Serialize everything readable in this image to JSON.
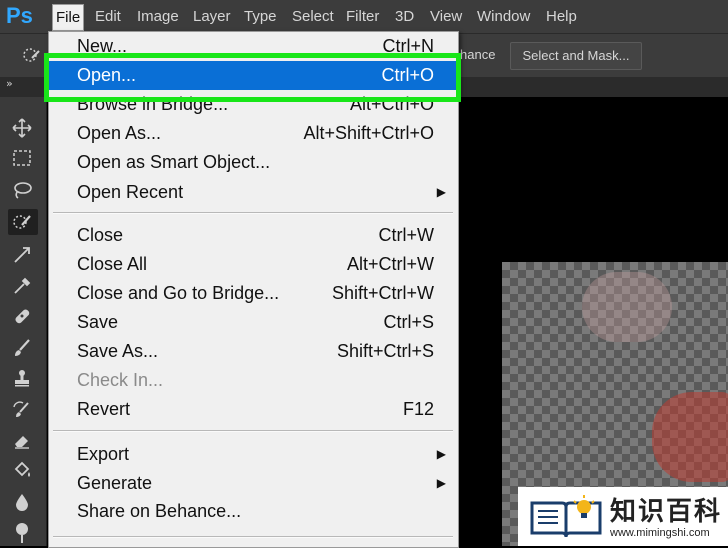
{
  "app": {
    "logo": "Ps"
  },
  "menubar": {
    "items": [
      "File",
      "Edit",
      "Image",
      "Layer",
      "Type",
      "Select",
      "Filter",
      "3D",
      "View",
      "Window",
      "Help"
    ]
  },
  "options_bar": {
    "behance_partial": "hance",
    "select_and_mask": "Select and Mask..."
  },
  "panel": {
    "collapse": "»"
  },
  "file_menu": {
    "items": [
      {
        "label": "New...",
        "shortcut": "Ctrl+N"
      },
      {
        "label": "Open...",
        "shortcut": "Ctrl+O",
        "highlight": true
      },
      {
        "label": "Browse in Bridge...",
        "shortcut": "Alt+Ctrl+O"
      },
      {
        "label": "Open As...",
        "shortcut": "Alt+Shift+Ctrl+O"
      },
      {
        "label": "Open as Smart Object...",
        "shortcut": ""
      },
      {
        "label": "Open Recent",
        "shortcut": "",
        "submenu": true
      },
      {
        "label": "Close",
        "shortcut": "Ctrl+W"
      },
      {
        "label": "Close All",
        "shortcut": "Alt+Ctrl+W"
      },
      {
        "label": "Close and Go to Bridge...",
        "shortcut": "Shift+Ctrl+W"
      },
      {
        "label": "Save",
        "shortcut": "Ctrl+S"
      },
      {
        "label": "Save As...",
        "shortcut": "Shift+Ctrl+S"
      },
      {
        "label": "Check In...",
        "shortcut": "",
        "disabled": true
      },
      {
        "label": "Revert",
        "shortcut": "F12"
      },
      {
        "label": "Export",
        "shortcut": "",
        "submenu": true
      },
      {
        "label": "Generate",
        "shortcut": "",
        "submenu": true
      },
      {
        "label": "Share on Behance...",
        "shortcut": ""
      }
    ]
  },
  "watermark": {
    "title": "知识百科",
    "url": "www.mimingshi.com"
  },
  "colors": {
    "menubar": "#3c3c3c",
    "menu_bg": "#f0f0f0",
    "highlight": "#0a6fd6",
    "annotation_box": "#19e619",
    "ps_blue": "#31a8ff"
  },
  "icons": {
    "tools": [
      "move-icon",
      "marquee-icon",
      "lasso-icon",
      "quick-selection-icon",
      "crop-icon",
      "eyedropper-icon",
      "healing-brush-icon",
      "brush-icon",
      "clone-stamp-icon",
      "history-brush-icon",
      "eraser-icon",
      "paint-bucket-icon",
      "blur-icon",
      "dodge-icon"
    ]
  }
}
